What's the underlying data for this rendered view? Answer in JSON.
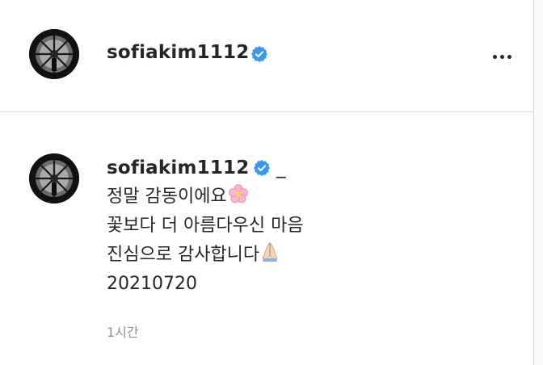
{
  "post_header": {
    "username": "sofiakim1112",
    "verified_icon": "verified-badge-icon",
    "more_icon": "more-options-icon"
  },
  "comment": {
    "username": "sofiakim1112",
    "mention": "_",
    "lines": [
      "정말 감동이에요",
      "꽃보다 더 아름다우신 마음",
      "진심으로 감사합니다",
      "20210720"
    ],
    "emojis": [
      "cherry-blossom-icon",
      "folded-hands-icon"
    ],
    "timestamp": "1시간"
  },
  "colors": {
    "verified": "#3897f0",
    "text": "#262626",
    "muted": "#8e8e8e",
    "border": "#dbdbdb"
  }
}
